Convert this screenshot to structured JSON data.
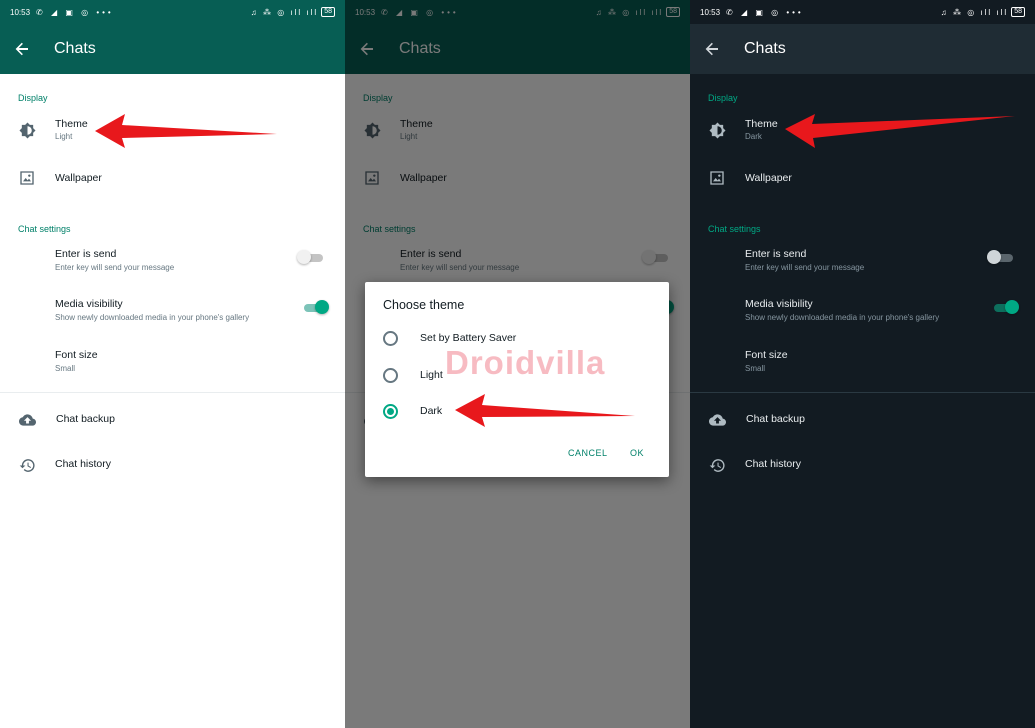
{
  "statusbar": {
    "time": "10:53",
    "notifications": "✆ ◢ ▣ ◎ •••",
    "system_icons": "♫ ⁂ ◎ ıll ıll",
    "battery": "58"
  },
  "appbar": {
    "title": "Chats"
  },
  "sections": {
    "display": "Display",
    "chat_settings": "Chat settings"
  },
  "rows": {
    "theme_title": "Theme",
    "wallpaper_title": "Wallpaper",
    "enter_send_title": "Enter is send",
    "enter_send_sub": "Enter key will send your message",
    "media_title": "Media visibility",
    "media_sub": "Show newly downloaded media in your phone's gallery",
    "font_title": "Font size",
    "font_sub": "Small",
    "backup_title": "Chat backup",
    "history_title": "Chat history"
  },
  "theme_values": {
    "light": "Light",
    "dark": "Dark"
  },
  "toggles": {
    "enter_is_send": false,
    "media_visibility": true
  },
  "dialog": {
    "title": "Choose theme",
    "options": [
      "Set by Battery Saver",
      "Light",
      "Dark"
    ],
    "selected": "Dark",
    "cancel": "CANCEL",
    "ok": "OK"
  },
  "watermark": "Droidvilla",
  "colors": {
    "header_green": "#075e54",
    "accent": "#00a884",
    "dark_background": "#121b22",
    "dark_header": "#1f2c34",
    "annotation_arrow": "#e8181c"
  },
  "icons": [
    "back-arrow-icon",
    "brightness-icon",
    "wallpaper-icon",
    "cloud-upload-icon",
    "history-icon"
  ]
}
